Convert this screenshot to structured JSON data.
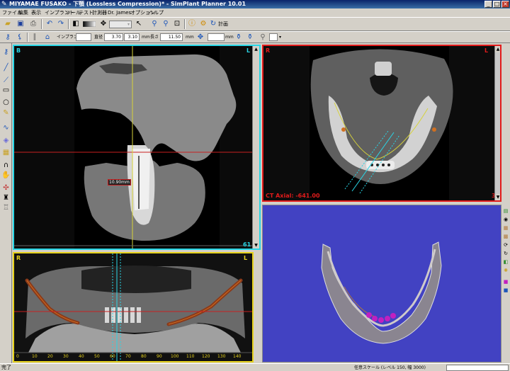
{
  "window": {
    "title": "MIYAMAE FUSAKO - 下顎 (Lossless Compression)* - SimPlant Planner  10.01",
    "buttons": {
      "minimize": "_",
      "maximize": "□",
      "close": "×"
    }
  },
  "menu": [
    "ファイル",
    "編集",
    "表示",
    "インプラント",
    "ツール",
    "テスト",
    "計測器",
    "Dr. James",
    "オプション",
    "ヘルプ"
  ],
  "toolbar": {
    "plan_label": "計画",
    "implant_label": "インプラント",
    "diameter_label": "直径",
    "diameter_value_1": "3.70",
    "diameter_value_2": "3.10",
    "diameter_unit": "mm",
    "length_label": "長さ",
    "length_value": "11.50",
    "length_unit": "mm",
    "extra_unit": "mm"
  },
  "views": {
    "cross_section": {
      "corner_left": "B",
      "corner_right": "L",
      "measurement": "10.90mm",
      "slice_number": "61"
    },
    "axial": {
      "corner_left": "R",
      "corner_right": "L",
      "caption": "CT Axial: -641.00",
      "slice_number": "32"
    },
    "panoramic": {
      "corner_left": "R",
      "corner_right": "L",
      "ruler_ticks": [
        "0",
        "10",
        "20",
        "30",
        "40",
        "50",
        "60",
        "70",
        "80",
        "90",
        "100",
        "110",
        "120",
        "130",
        "140"
      ]
    }
  },
  "status": {
    "left": "完了",
    "right": "任意スケール (レベル 150, 幅 3000)"
  },
  "colors": {
    "cross_section_frame": "#29d6e6",
    "axial_frame": "#e21b1b",
    "panoramic_frame": "#e6d21d",
    "view3d_background": "#4242c2",
    "nerve_canal": "#8b3a1a",
    "implant_highlight": "#c020c0"
  }
}
